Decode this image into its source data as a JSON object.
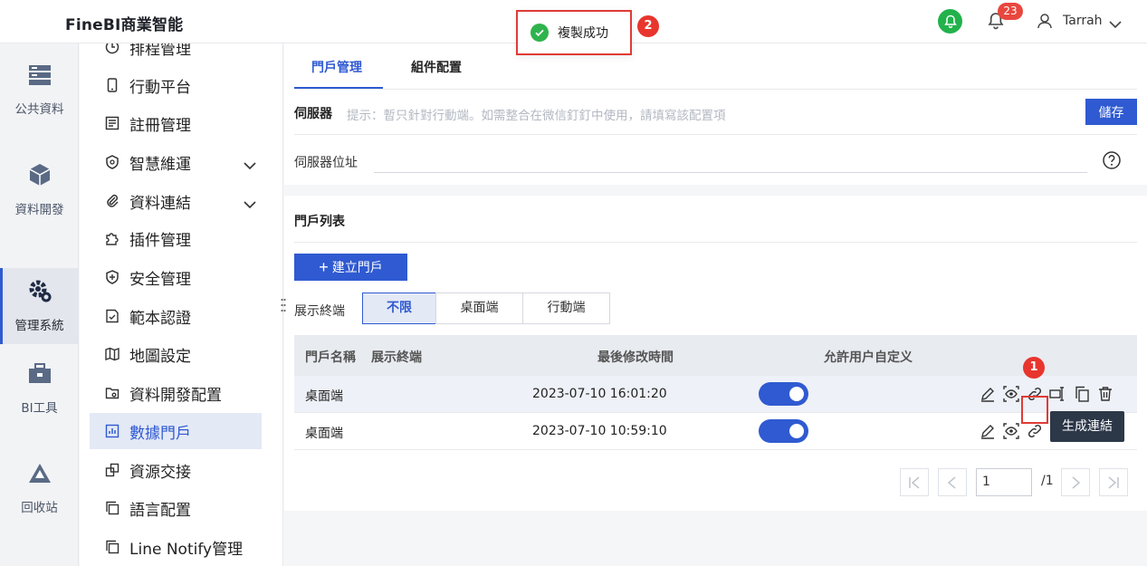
{
  "header": {
    "brand": "FineBI商業智能",
    "notification_count": "23",
    "user_name": "Tarrah"
  },
  "toast": {
    "message": "複製成功",
    "step_number": "2"
  },
  "rail": {
    "items": [
      {
        "label": "公共資料",
        "icon": "database-icon"
      },
      {
        "label": "資料開發",
        "icon": "cube-icon"
      },
      {
        "label": "管理系統",
        "icon": "gear-icon",
        "active": true
      },
      {
        "label": "BI工具",
        "icon": "toolbox-icon"
      },
      {
        "label": "回收站",
        "icon": "recycle-icon"
      }
    ]
  },
  "nav": {
    "items": [
      {
        "label": "排程管理"
      },
      {
        "label": "行動平台"
      },
      {
        "label": "註冊管理"
      },
      {
        "label": "智慧維運"
      },
      {
        "label": "資料連結"
      },
      {
        "label": "插件管理"
      },
      {
        "label": "安全管理"
      },
      {
        "label": "範本認證"
      },
      {
        "label": "地圖設定"
      },
      {
        "label": "資料開發配置"
      },
      {
        "label": "數據門戶",
        "active": true
      },
      {
        "label": "資源交接"
      },
      {
        "label": "語言配置"
      },
      {
        "label": "Line Notify管理"
      }
    ]
  },
  "tabs": [
    {
      "label": "門戶管理",
      "active": true
    },
    {
      "label": "組件配置"
    }
  ],
  "server": {
    "label": "伺服器",
    "hint": "提示：暫只針對行動端。如需整合在微信釘釘中使用，請填寫該配置項",
    "save_label": "儲存",
    "address_label": "伺服器位址",
    "address_value": ""
  },
  "portal_list": {
    "title": "門戶列表",
    "create_label": "建立門戶",
    "terminal_label": "展示終端",
    "segments": [
      "不限",
      "桌面端",
      "行動端"
    ],
    "active_segment": "不限",
    "columns": [
      "門戶名稱",
      "展示終端",
      "最後修改時間",
      "允許用户自定义"
    ],
    "rows": [
      {
        "name": "桌面端",
        "modified": "2023-07-10 16:01:20",
        "allow_custom": true
      },
      {
        "name": "桌面端",
        "modified": "2023-07-10 10:59:10",
        "allow_custom": true
      }
    ],
    "tooltip": "生成連結",
    "step_number": "1"
  },
  "pagination": {
    "current": "1",
    "total": "/1"
  },
  "colors": {
    "primary": "#2f5ad1",
    "highlight_red": "#e03b36",
    "success_green": "#22b24c"
  }
}
